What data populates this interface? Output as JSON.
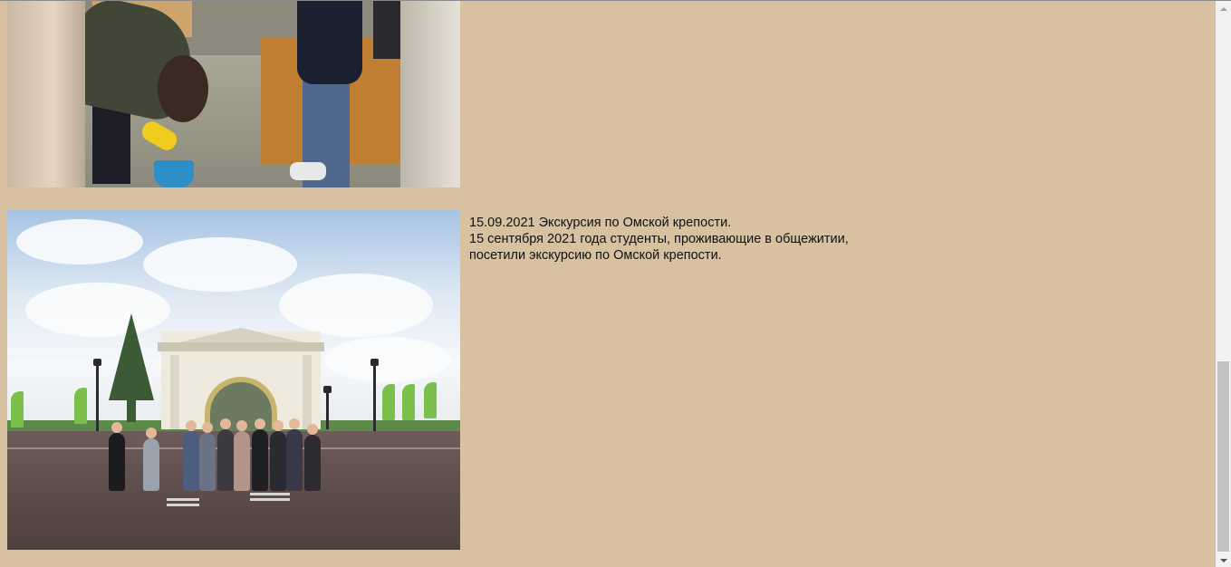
{
  "entries": [
    {
      "photo": {
        "description_icon": "students-cleaning-photo"
      }
    },
    {
      "photo": {
        "description_icon": "omsk-fortress-excursion-photo"
      },
      "caption": {
        "line1": "15.09.2021 Экскурсия по Омской крепости.",
        "line2": "15 сентября 2021 года студенты, проживающие в общежитии,",
        "line3": "посетили экскурсию по Омской крепости."
      }
    }
  ],
  "colors": {
    "page_background": "#d8c1a1",
    "text": "#111111",
    "scrollbar_track": "#f1f1f1",
    "scrollbar_thumb": "#c1c1c1"
  },
  "scroll": {
    "position_fraction": 0.66
  }
}
